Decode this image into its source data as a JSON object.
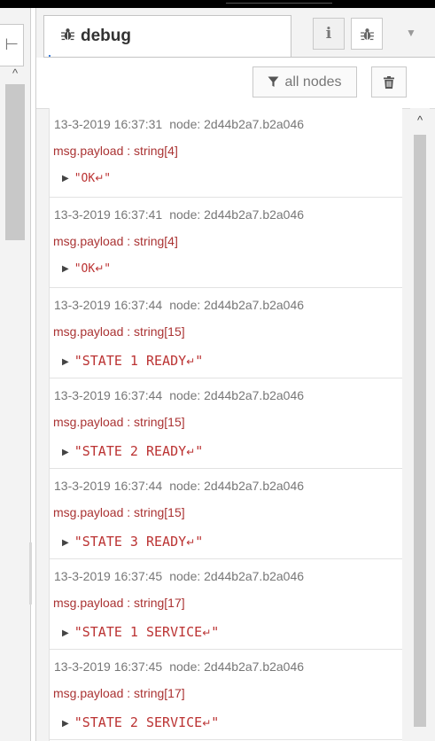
{
  "sidebar": {
    "tab_glyph": "⊢",
    "scroll_up": "^"
  },
  "panel": {
    "tab_label": "debug",
    "info_btn": "i",
    "more_btn": "▼",
    "filter_label": "all nodes"
  },
  "messages": [
    {
      "time": "13-3-2019 16:37:31",
      "node": "node: 2d44b2a7.b2a046",
      "topic": "msg.payload : string[4]",
      "text": "\"OK",
      "end": "\"",
      "size": "small"
    },
    {
      "time": "13-3-2019 16:37:41",
      "node": "node: 2d44b2a7.b2a046",
      "topic": "msg.payload : string[4]",
      "text": "\"OK",
      "end": "\"",
      "size": "small"
    },
    {
      "time": "13-3-2019 16:37:44",
      "node": "node: 2d44b2a7.b2a046",
      "topic": "msg.payload : string[15]",
      "text": "\"STATE 1 READY",
      "end": "\"",
      "size": "big"
    },
    {
      "time": "13-3-2019 16:37:44",
      "node": "node: 2d44b2a7.b2a046",
      "topic": "msg.payload : string[15]",
      "text": "\"STATE 2 READY",
      "end": "\"",
      "size": "big"
    },
    {
      "time": "13-3-2019 16:37:44",
      "node": "node: 2d44b2a7.b2a046",
      "topic": "msg.payload : string[15]",
      "text": "\"STATE 3 READY",
      "end": "\"",
      "size": "big"
    },
    {
      "time": "13-3-2019 16:37:45",
      "node": "node: 2d44b2a7.b2a046",
      "topic": "msg.payload : string[17]",
      "text": "\"STATE 1 SERVICE",
      "end": "\"",
      "size": "big"
    },
    {
      "time": "13-3-2019 16:37:45",
      "node": "node: 2d44b2a7.b2a046",
      "topic": "msg.payload : string[17]",
      "text": "\"STATE 2 SERVICE",
      "end": "\"",
      "size": "big"
    }
  ],
  "icons": {
    "tab": "bug-icon",
    "info": "info-icon",
    "debug_btn": "bug-icon",
    "more": "chevron-down-icon",
    "filter": "filter-icon",
    "trash": "trash-icon",
    "expand": "caret-right-icon",
    "newline": "return-icon"
  },
  "colors": {
    "payload": "#b33333",
    "meta": "#777777",
    "scrollbar": "#c8c8c8"
  }
}
